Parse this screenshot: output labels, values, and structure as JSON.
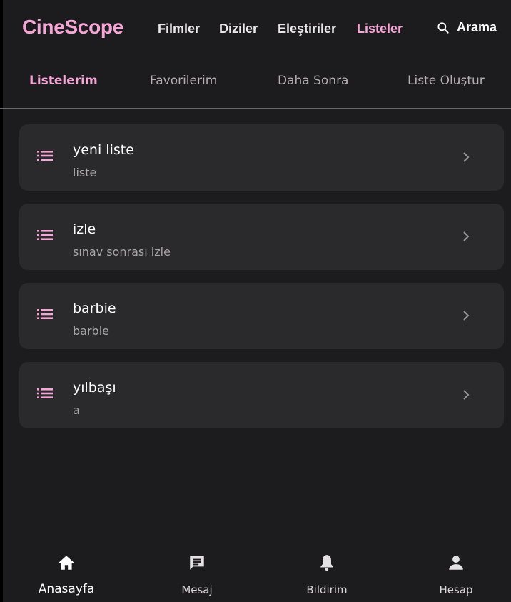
{
  "header": {
    "brand": "CineScope",
    "nav": [
      "Filmler",
      "Diziler",
      "Eleştiriler",
      "Listeler"
    ],
    "active_nav": "Listeler",
    "search_label": "Arama"
  },
  "tabs": [
    "Listelerim",
    "Favorilerim",
    "Daha Sonra",
    "Liste Oluştur"
  ],
  "active_tab": "Listelerim",
  "lists": [
    {
      "title": "yeni liste",
      "subtitle": "liste"
    },
    {
      "title": "izle",
      "subtitle": "sınav sonrası izle"
    },
    {
      "title": "barbie",
      "subtitle": "barbie"
    },
    {
      "title": "yılbaşı",
      "subtitle": "a"
    }
  ],
  "bottom_nav": [
    {
      "label": "Anasayfa",
      "icon": "home-icon"
    },
    {
      "label": "Mesaj",
      "icon": "message-icon"
    },
    {
      "label": "Bildirim",
      "icon": "bell-icon"
    },
    {
      "label": "Hesap",
      "icon": "person-icon"
    }
  ],
  "active_bottom": "Anasayfa",
  "colors": {
    "accent": "#f4a6d6",
    "background": "#1c1b1d",
    "card": "#2a292c",
    "muted_text": "#a9a6ab"
  }
}
